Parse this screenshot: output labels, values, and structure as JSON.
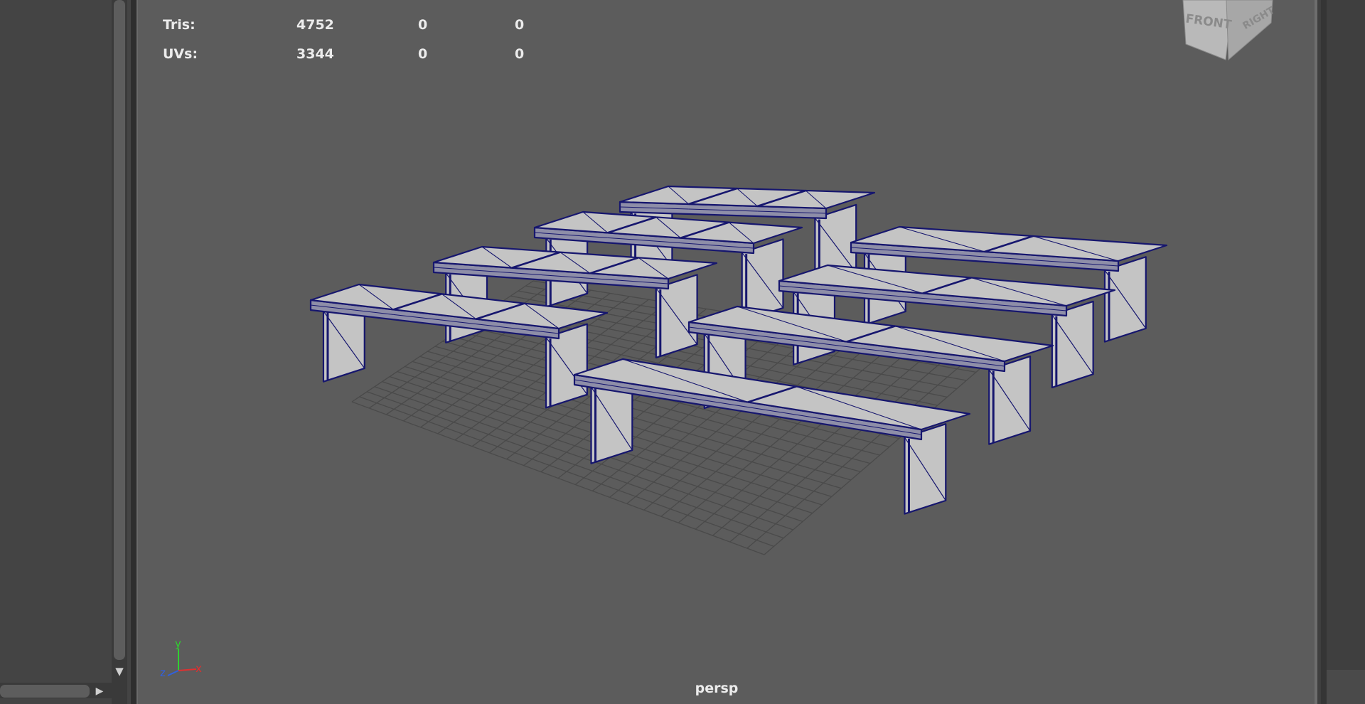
{
  "hud": {
    "rows": [
      {
        "label": "Tris:",
        "values": [
          "4752",
          "0",
          "0"
        ]
      },
      {
        "label": "UVs:",
        "values": [
          "3344",
          "0",
          "0"
        ]
      }
    ]
  },
  "viewcube": {
    "front_label": "FRONT",
    "right_label": "RIGHT"
  },
  "axis": {
    "y_label": "y",
    "z_label": "z",
    "x_label": "x"
  },
  "camera": {
    "name": "persp"
  },
  "icons": {
    "scroll_down": "▼",
    "scroll_right": "▶"
  },
  "colors": {
    "viewport_bg": "#5c5c5c",
    "wireframe": "#16166e",
    "mesh_fill": "#c4c4c4",
    "grid": "#4a4a4a",
    "axis_x": "#e03030",
    "axis_y": "#30d030",
    "axis_z": "#3060e0"
  }
}
